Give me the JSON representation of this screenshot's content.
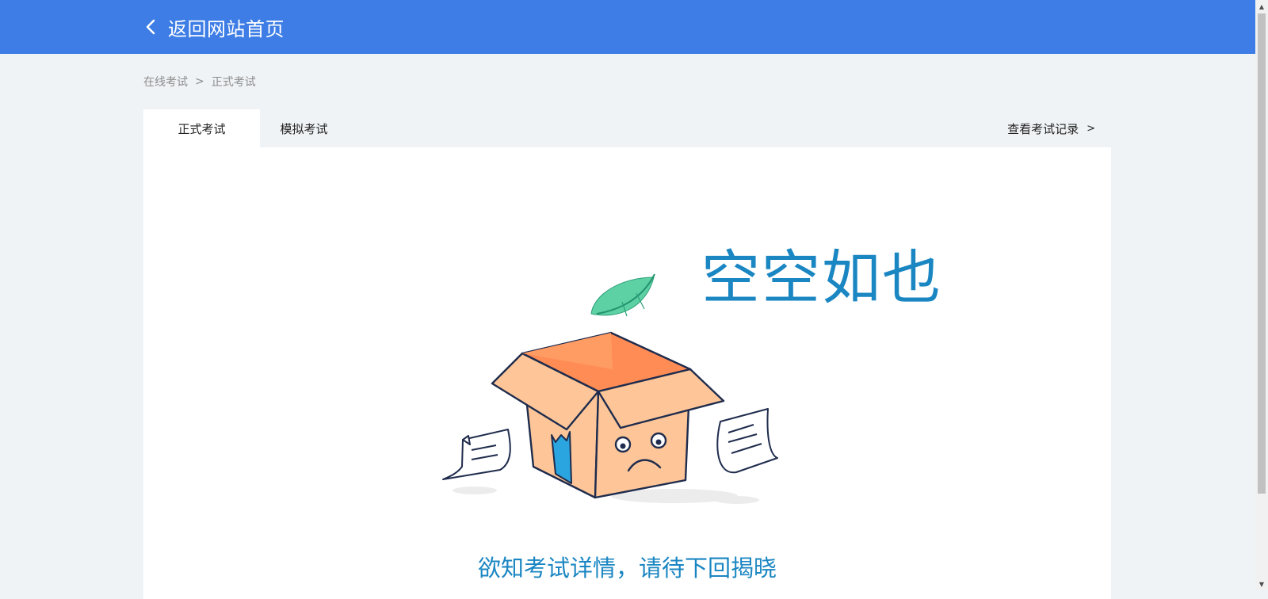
{
  "header": {
    "back_label": "返回网站首页",
    "background_color": "#3d7de5"
  },
  "breadcrumb": {
    "items": [
      "在线考试",
      "正式考试"
    ],
    "separator": ">"
  },
  "tabs": [
    {
      "label": "正式考试",
      "active": true
    },
    {
      "label": "模拟考试",
      "active": false
    }
  ],
  "record_link": {
    "label": "查看考试记录",
    "arrow": ">"
  },
  "empty_state": {
    "title": "空空如也",
    "subtitle": "欲知考试详情，请待下回揭晓",
    "accent_color": "#1a86c2",
    "illustration": "empty-box-illustration"
  },
  "scrollbar": {
    "up_arrow": "▲",
    "down_arrow": "▼"
  }
}
